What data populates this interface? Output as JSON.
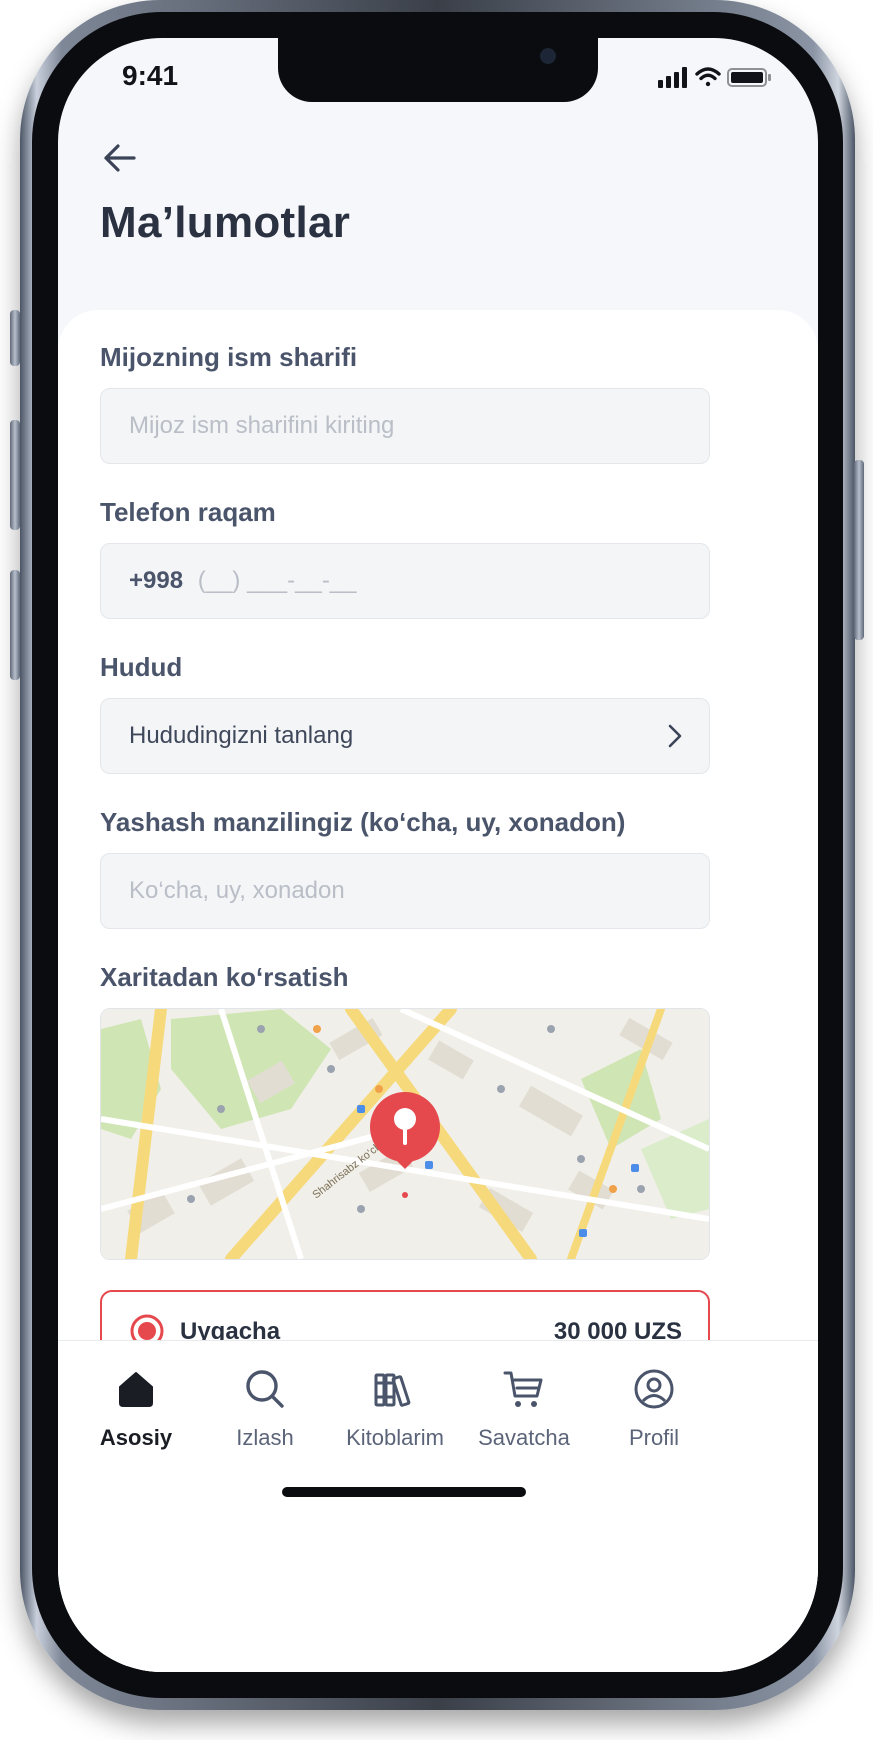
{
  "status_bar": {
    "time": "9:41"
  },
  "header": {
    "title": "Ma’lumotlar"
  },
  "form": {
    "name": {
      "label": "Mijozning ism sharifi",
      "placeholder": "Mijoz ism sharifini kiriting",
      "value": ""
    },
    "phone": {
      "label": "Telefon raqam",
      "prefix": "+998",
      "mask": "(__) ___-__-__"
    },
    "region": {
      "label": "Hudud",
      "value": "Hududingizni tanlang"
    },
    "address": {
      "label": "Yashash manzilingiz (ko‘cha, uy, xonadon)",
      "placeholder": "Ko‘cha, uy, xonadon",
      "value": ""
    },
    "map": {
      "label": "Xaritadan ko‘rsatish",
      "street_label": "Shahrisabz ko‘chasi"
    }
  },
  "delivery": {
    "option": "Uygacha",
    "price": "30 000 UZS",
    "selected": true
  },
  "tabbar": {
    "items": [
      {
        "label": "Asosiy",
        "icon": "home-icon",
        "active": true
      },
      {
        "label": "Izlash",
        "icon": "search-icon",
        "active": false
      },
      {
        "label": "Kitoblarim",
        "icon": "books-icon",
        "active": false
      },
      {
        "label": "Savatcha",
        "icon": "cart-icon",
        "active": false
      },
      {
        "label": "Profil",
        "icon": "profile-icon",
        "active": false
      }
    ]
  },
  "colors": {
    "accent": "#e5484d",
    "text_dark": "#2a3141",
    "text_label": "#4a546a",
    "field_bg": "#f4f5f7"
  }
}
